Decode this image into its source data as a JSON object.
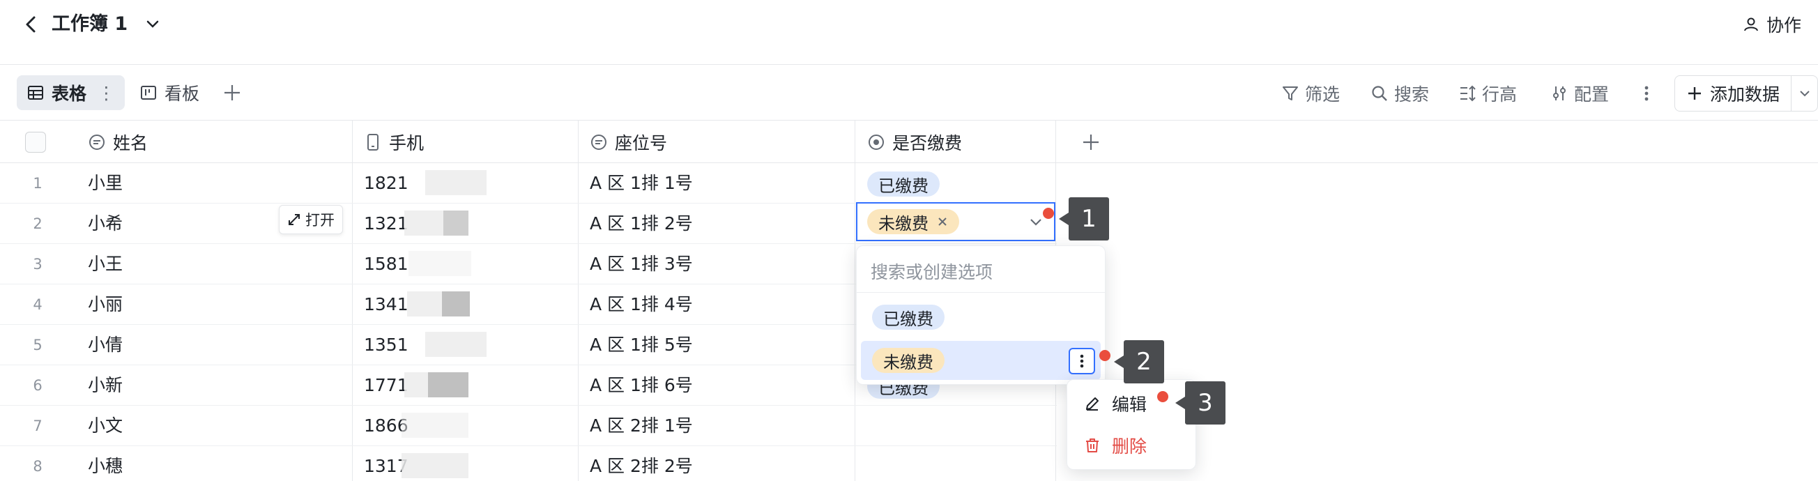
{
  "header": {
    "title": "工作簿 1",
    "collab_label": "协作"
  },
  "views": {
    "table_label": "表格",
    "kanban_label": "看板"
  },
  "toolbar": {
    "filter": "筛选",
    "search": "搜索",
    "row_height": "行高",
    "config": "配置",
    "add_data": "添加数据"
  },
  "columns": [
    {
      "label": "姓名",
      "icon": "text-field-icon"
    },
    {
      "label": "手机",
      "icon": "phone-field-icon"
    },
    {
      "label": "座位号",
      "icon": "text-field-icon"
    },
    {
      "label": "是否缴费",
      "icon": "single-select-icon"
    }
  ],
  "rows": [
    {
      "num": "1",
      "name": "小里",
      "phone": "1821",
      "seat": "A 区 1排 1号",
      "status": "已缴费"
    },
    {
      "num": "2",
      "name": "小希",
      "phone": "1321",
      "seat": "A 区 1排 2号",
      "status": "未缴费"
    },
    {
      "num": "3",
      "name": "小王",
      "phone": "1581",
      "seat": "A 区 1排 3号",
      "status": ""
    },
    {
      "num": "4",
      "name": "小丽",
      "phone": "1341",
      "seat": "A 区 1排 4号",
      "status": ""
    },
    {
      "num": "5",
      "name": "小倩",
      "phone": "1351",
      "seat": "A 区 1排 5号",
      "status": ""
    },
    {
      "num": "6",
      "name": "小新",
      "phone": "1771",
      "seat": "A 区 1排 6号",
      "status": "已缴费"
    },
    {
      "num": "7",
      "name": "小文",
      "phone": "1866",
      "seat": "A 区 2排 1号",
      "status": ""
    },
    {
      "num": "8",
      "name": "小穗",
      "phone": "1317",
      "seat": "A 区 2排 2号",
      "status": ""
    }
  ],
  "open_button": "打开",
  "dropdown": {
    "search_placeholder": "搜索或创建选项",
    "options": [
      "已缴费",
      "未缴费"
    ]
  },
  "context_menu": {
    "edit": "编辑",
    "delete": "删除"
  },
  "callouts": [
    "1",
    "2",
    "3"
  ],
  "colors": {
    "accent": "#3370ff",
    "paid_tag": "#dde8fb",
    "unpaid_tag": "#fbe6bd",
    "danger": "#e34b45",
    "marker": "#ea4e3d"
  }
}
